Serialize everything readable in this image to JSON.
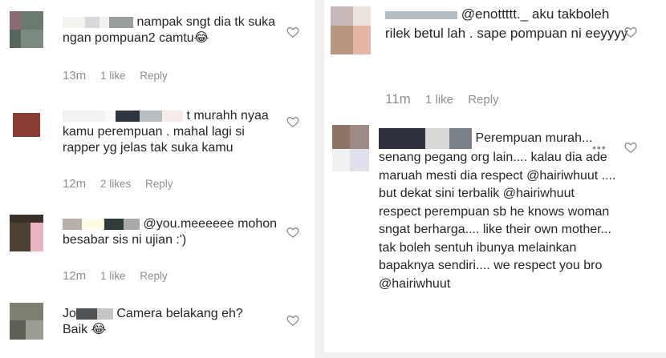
{
  "left_comments": [
    {
      "text": "nampak sngt dia tk suka ngan pompuan2 camtu😂",
      "time": "13m",
      "likes": "1 like",
      "reply": "Reply"
    },
    {
      "text": "t murahh nyaa kamu perempuan . mahal lagi si rapper yg jelas tak suka kamu",
      "time": "12m",
      "likes": "2 likes",
      "reply": "Reply"
    },
    {
      "text": "@you.meeeeee mohon besabar sis ni ujian :')",
      "time": "12m",
      "likes": "1 like",
      "reply": "Reply"
    },
    {
      "text": "Camera belakang eh? Baik 😂",
      "username_fragment": "Jo",
      "time": "",
      "likes": "",
      "reply": ""
    }
  ],
  "right_comments": [
    {
      "text": "@enottttt._ aku takboleh rilek betul lah . sape pompuan ni eeyyyy",
      "time": "11m",
      "likes": "1 like",
      "reply": "Reply"
    },
    {
      "text": "Perempuan murah... senang pegang org lain.... kalau dia ade maruah mesti dia respect @hairiwhuut .... but dekat sini terbalik @hairiwhuut respect perempuan sb he knows woman sngat berharga.... like their own mother... tak boleh sentuh ibunya melainkan bapaknya sendiri.... we respect you bro @hairiwhuut",
      "more_label": "•••"
    }
  ],
  "icons": {
    "like": "heart-icon",
    "more": "more-options-icon"
  },
  "colors": {
    "text": "#262626",
    "meta": "#8e8e8e",
    "divider": "#f0f0f0"
  }
}
